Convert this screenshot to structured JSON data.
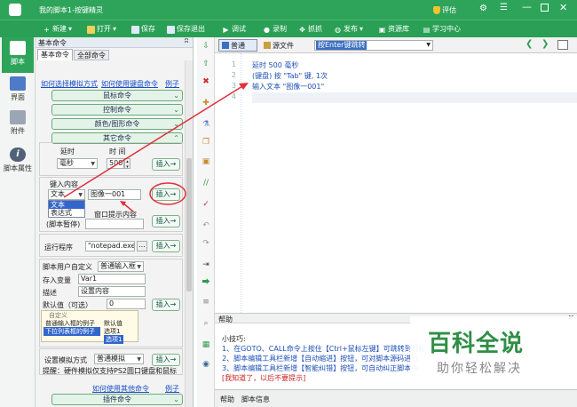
{
  "app": {
    "title": "我的脚本1-按键精灵",
    "vip": "评估"
  },
  "toolbar": {
    "new": "新建",
    "open": "打开",
    "save": "保存",
    "save_exit": "保存退出",
    "debug": "调试",
    "record": "录制",
    "grab": "抓抓",
    "publish": "发布",
    "resources": "资源库",
    "learn": "学习中心"
  },
  "rail": {
    "script": "脚本",
    "ui": "界面",
    "attach": "附件",
    "props": "脚本属性"
  },
  "panel": {
    "title": "基本命令",
    "pin": "ʭ",
    "tabs": [
      "基本命令",
      "全部命令"
    ],
    "link_keys": "如何选择模拟方式",
    "link_kb": "如何使用键盘命令",
    "link_example": "例子",
    "cats": [
      "鼠标命令",
      "控制命令",
      "颜色/图形命令",
      "其它命令"
    ],
    "delay_label": "延时",
    "time_label": "时 间",
    "unit": "毫秒",
    "time_value": "500",
    "insert": "插入→",
    "key_label": "键入内容",
    "key_mode": "文本",
    "key_text": "图像一001",
    "dd_items": [
      "文本",
      "表达式"
    ],
    "prompt_label": "窗口提示内容",
    "pause_text": "(脚本暂停)",
    "run_label": "运行程序",
    "run_value": "\"notepad.exe\"",
    "browse": "...",
    "custom_label": "脚本用户自定义",
    "custom_type": "普通输入框",
    "store_label": "存入变量",
    "store_value": "Var1",
    "desc_label": "描述",
    "desc_value": "设置内容",
    "default_label": "默认值（可选）",
    "default_value": "0",
    "sample_title": "自定义",
    "sample_r1a": "普通输入框的例子",
    "sample_r1b": "默认值",
    "sample_r2a": "下拉列表框的例子",
    "sample_r2b": "选项1",
    "sample_r3b": "选项1",
    "hw_label": "设置模拟方式",
    "hw_mode": "普通模拟",
    "hw_tip": "提醒：硬件模拟仅支持PS2圆口键盘和鼠标",
    "link_other": "如何使用其他命令",
    "link_example2": "例子",
    "plugin": "插件命令"
  },
  "editor": {
    "tab_normal": "普通",
    "tab_source": "源文件",
    "combo": "按Enter键跳转",
    "lines": [
      "1",
      "2",
      "3",
      "4"
    ],
    "code": [
      "延时 500 毫秒",
      "(键盘) 按 \"Tab\" 键, 1次",
      "输入文本 \"图像一001\""
    ]
  },
  "help": {
    "title": "帮助",
    "tip_title": "小技巧:",
    "tips": [
      "1、在GOTO、CALL命令上按住【Ctrl+鼠标左键】可跳转到目标",
      "2、脚本编辑工具栏新增【自动缩进】按钮，可对脚本源码进行",
      "3、脚本编辑工具栏新增【智能纠错】按钮，可自动纠正脚本中"
    ],
    "dismiss": "[我知道了，以后不要提示]",
    "tab_help": "帮助",
    "tab_info": "脚本信息"
  },
  "watermark": {
    "title": "百科全说",
    "subtitle": "助你轻松解决"
  },
  "colors": {
    "brand": "#2ea45a",
    "annotation": "#e0303a",
    "link": "#1a4fc7"
  }
}
